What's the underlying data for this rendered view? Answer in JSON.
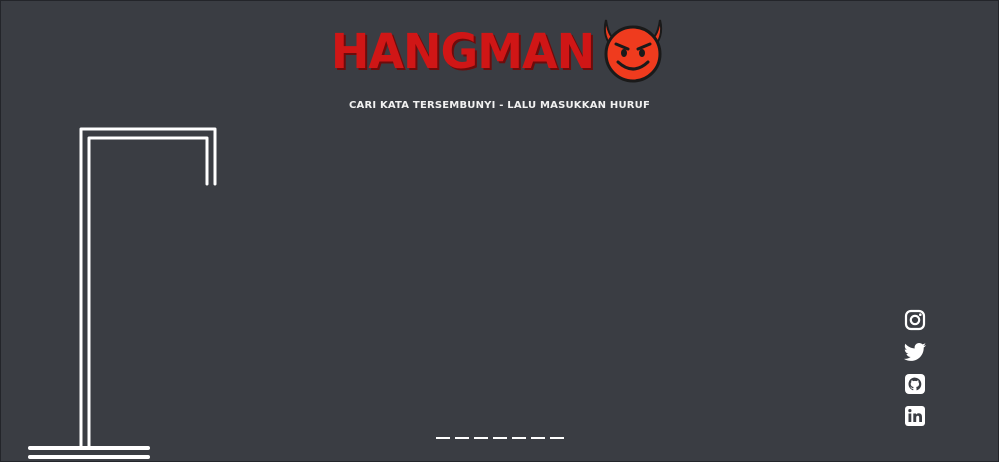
{
  "header": {
    "title": "HANGMAN",
    "subtitle": "CARI KATA TERSEMBUNYI - LALU MASUKKAN HURUF",
    "emoji": "smiling-devil-icon"
  },
  "colors": {
    "background": "#3a3d43",
    "title": "#d01616",
    "devil_face": "#ef3b1e",
    "lines": "#ffffff"
  },
  "game": {
    "word_slots": [
      "",
      "",
      "",
      "",
      "",
      "",
      ""
    ],
    "word_length": 7
  },
  "socials": [
    {
      "name": "instagram-icon"
    },
    {
      "name": "twitter-icon"
    },
    {
      "name": "github-icon"
    },
    {
      "name": "linkedin-icon"
    }
  ]
}
